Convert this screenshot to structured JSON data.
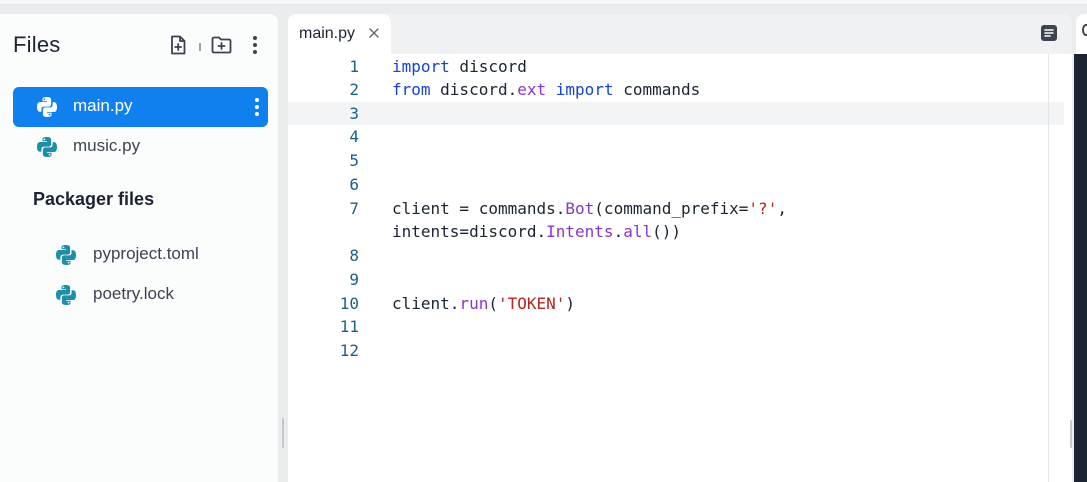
{
  "files_panel": {
    "title": "Files",
    "files": [
      {
        "name": "main.py",
        "active": true
      },
      {
        "name": "music.py",
        "active": false
      }
    ],
    "packager_title": "Packager files",
    "packager_files": [
      {
        "name": "pyproject.toml"
      },
      {
        "name": "poetry.lock"
      }
    ]
  },
  "editor": {
    "tab": {
      "label": "main.py"
    },
    "lines": [
      {
        "num": "1"
      },
      {
        "num": "2"
      },
      {
        "num": "3"
      },
      {
        "num": "4"
      },
      {
        "num": "5"
      },
      {
        "num": "6"
      },
      {
        "num": "7"
      },
      {
        "num": ""
      },
      {
        "num": "8"
      },
      {
        "num": "9"
      },
      {
        "num": "10"
      },
      {
        "num": "11"
      },
      {
        "num": "12"
      }
    ],
    "code": {
      "l1_kw": "import",
      "l1_rest": " discord",
      "l2_kw1": "from",
      "l2_a": " discord.",
      "l2_fn": "ext",
      "l2_sp": " ",
      "l2_kw2": "import",
      "l2_rest": " commands",
      "l7_a": "client = commands.",
      "l7_fn": "Bot",
      "l7_b": "(command_prefix=",
      "l7_str": "'?'",
      "l7_c": ",",
      "l7w_a": "intents=discord.",
      "l7w_fn1": "Intents",
      "l7w_b": ".",
      "l7w_fn2": "all",
      "l7w_c": "())",
      "l10_a": "client.",
      "l10_fn": "run",
      "l10_b": "(",
      "l10_str": "'TOKEN'",
      "l10_c": ")"
    }
  },
  "colors": {
    "accent": "#0f80ee",
    "keyword": "#1442d6",
    "function": "#8a35c8",
    "string": "#b3261e",
    "line_number": "#1c5e8c"
  },
  "icons": {
    "new_file": "file-plus-icon",
    "new_folder": "folder-plus-icon",
    "menu": "kebab-menu-icon",
    "python": "python-icon",
    "close": "close-icon",
    "split": "layout-icon"
  }
}
